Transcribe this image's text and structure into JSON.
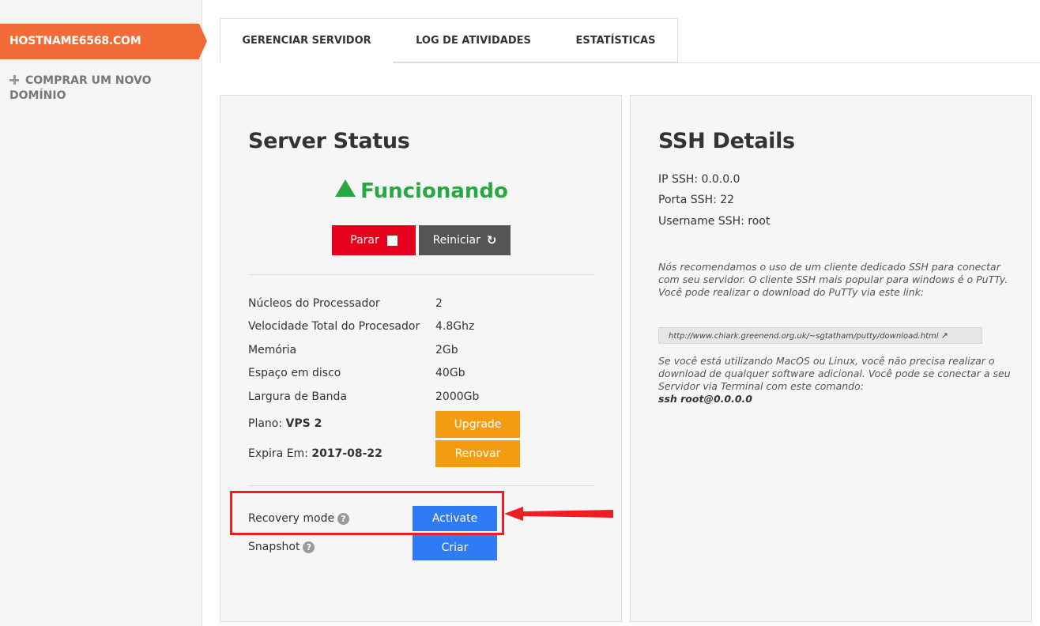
{
  "sidebar": {
    "active_domain": "HOSTNAME6568.COM",
    "buy_domain": "COMPRAR UM NOVO DOMÍNIO"
  },
  "tabs": [
    {
      "label": "GERENCIAR SERVIDOR"
    },
    {
      "label": "LOG DE ATIVIDADES"
    },
    {
      "label": "ESTATÍSTICAS"
    }
  ],
  "server": {
    "title": "Server Status",
    "status": "Funcionando",
    "stop_label": "Parar",
    "restart_label": "Reiniciar",
    "specs": [
      {
        "label": "Núcleos do Processador",
        "value": "2"
      },
      {
        "label": "Velocidade Total do Procesador",
        "value": "4.8Ghz"
      },
      {
        "label": "Memória",
        "value": "2Gb"
      },
      {
        "label": "Espaço em disco",
        "value": "40Gb"
      },
      {
        "label": "Largura de Banda",
        "value": "2000Gb"
      }
    ],
    "plan_label": "Plano:",
    "plan_value": "VPS 2",
    "upgrade_label": "Upgrade",
    "expires_label": "Expira Em:",
    "expires_value": "2017-08-22",
    "renew_label": "Renovar",
    "recovery_label": "Recovery mode",
    "recovery_button": "Activate",
    "snapshot_label": "Snapshot",
    "snapshot_button": "Criar"
  },
  "ssh": {
    "title": "SSH Details",
    "ip": "IP SSH: 0.0.0.0",
    "port": "Porta SSH: 22",
    "username": "Username SSH: root",
    "note1": "Nós recomendamos o uso de um cliente dedicado SSH para conectar com seu servidor. O cliente SSH mais popular para windows é o PuTTy. Você pode realizar o download do PuTTy via este link:",
    "link": "http://www.chiark.greenend.org.uk/~sgtatham/putty/download.html",
    "note2": "Se você está utilizando MacOS ou Linux, você não precisa realizar o download de qualquer software adicional. Você pode se conectar a seu Servidor via Terminal com este comando:",
    "command": "ssh root@0.0.0.0"
  },
  "colors": {
    "sidebar_active": "#f26b36",
    "status_green": "#28a745",
    "stop_red": "#e5001b",
    "orange": "#f39c12",
    "blue": "#2f7bf4",
    "highlight_red": "#ef1e25"
  }
}
